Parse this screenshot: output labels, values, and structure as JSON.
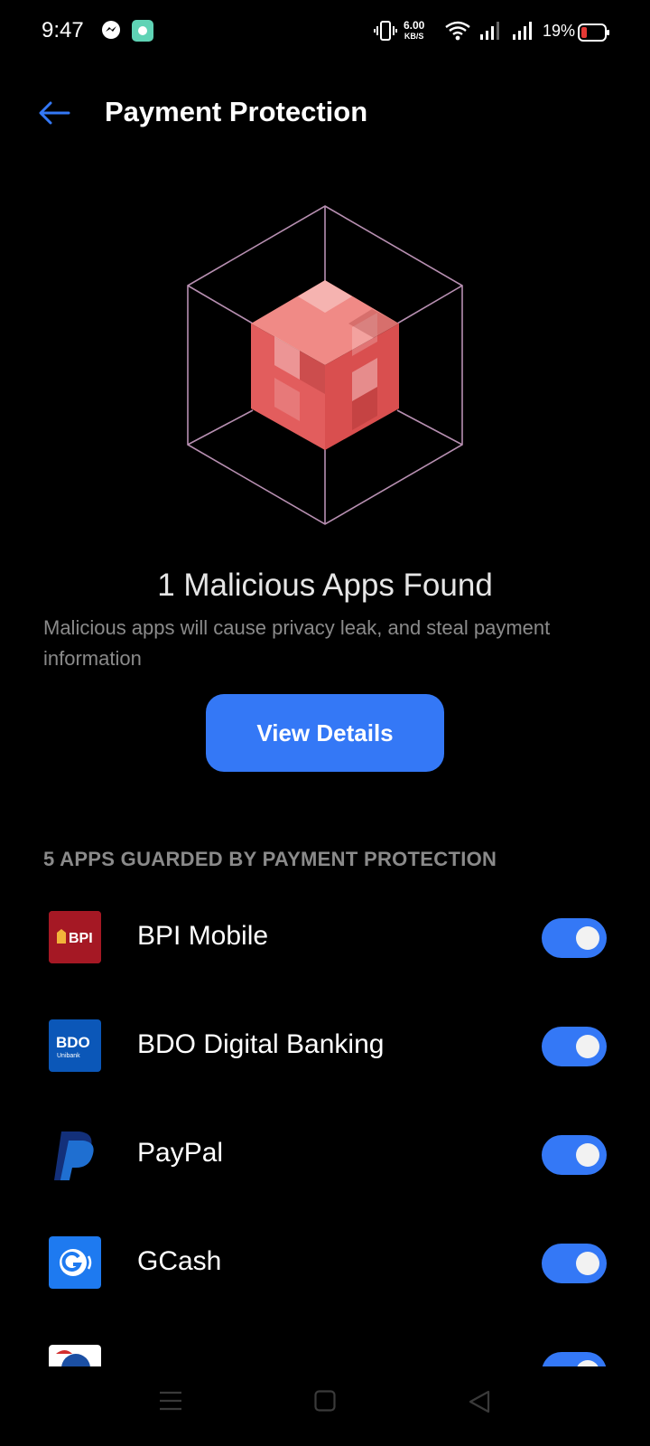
{
  "status": {
    "time": "9:47",
    "speed_value": "6.00",
    "speed_unit": "KB/S",
    "battery": "19%"
  },
  "header": {
    "title": "Payment Protection"
  },
  "scan": {
    "result": "1 Malicious Apps Found",
    "description": "Malicious apps will cause privacy leak, and steal payment information",
    "button_label": "View Details"
  },
  "apps": {
    "section_title": "5 APPS GUARDED BY PAYMENT PROTECTION",
    "items": [
      {
        "name": "BPI Mobile",
        "icon": "bpi-logo",
        "icon_text": "BPI",
        "enabled": true
      },
      {
        "name": "BDO Digital Banking",
        "icon": "bdo-logo",
        "icon_text": "BDO",
        "icon_subtext": "Unibank",
        "enabled": true
      },
      {
        "name": "PayPal",
        "icon": "paypal-logo",
        "enabled": true
      },
      {
        "name": "GCash",
        "icon": "gcash-logo",
        "enabled": true
      },
      {
        "name": "",
        "icon": "partial-logo",
        "enabled": true
      }
    ]
  },
  "colors": {
    "accent": "#3478f6",
    "background": "#000000",
    "threat_cube": "#e25d5d"
  }
}
